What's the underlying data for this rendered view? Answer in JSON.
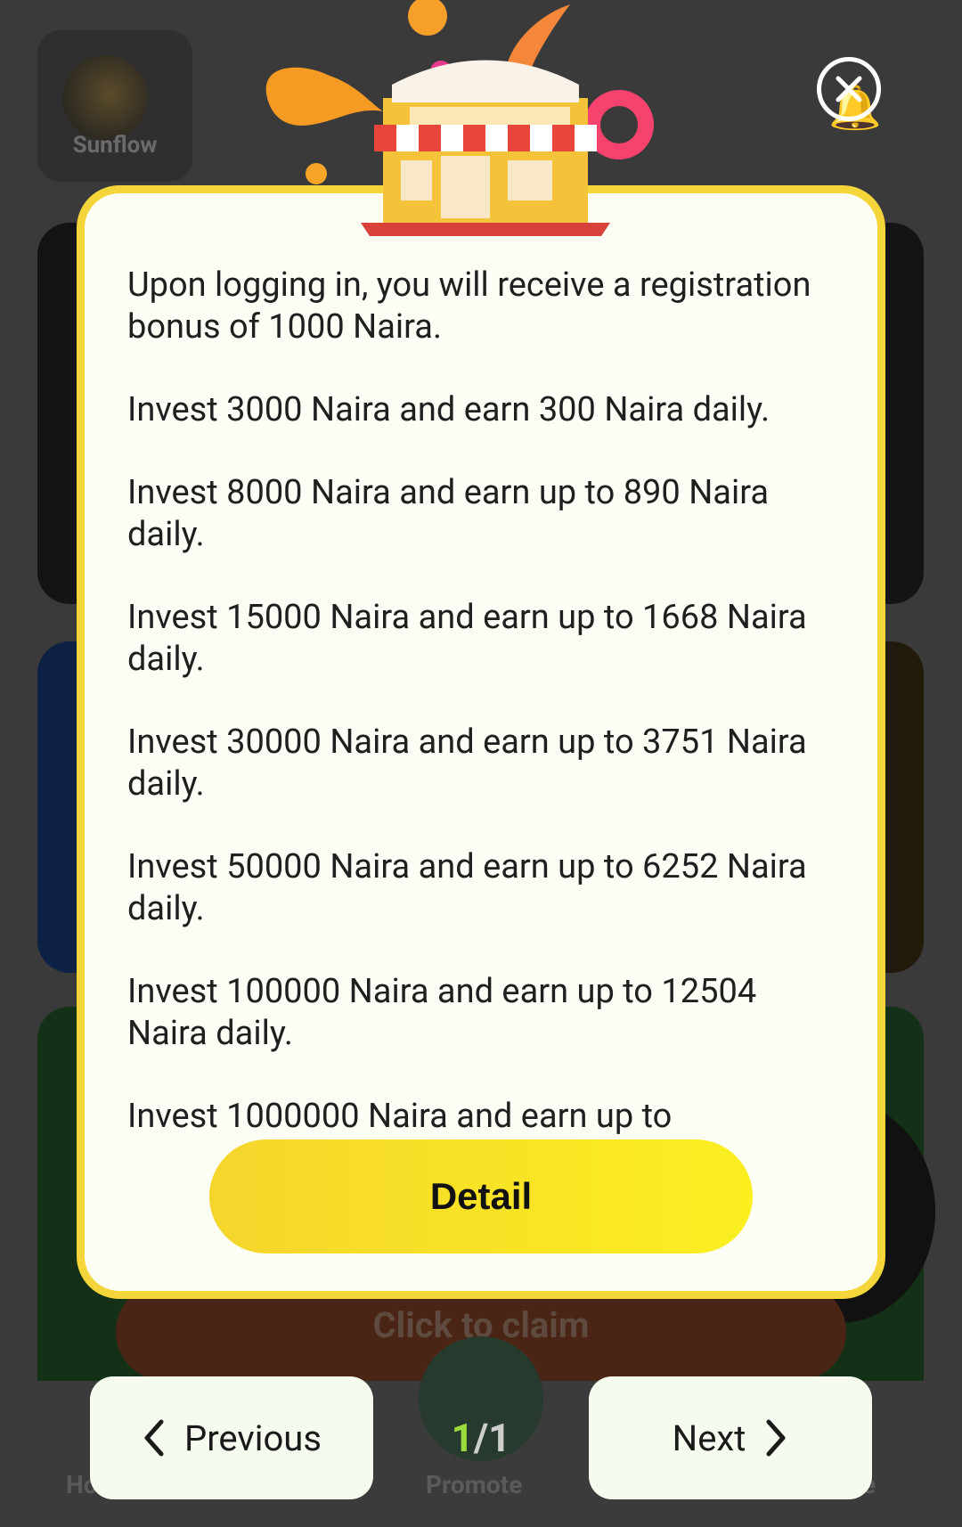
{
  "background": {
    "logo_label": "Sunflow",
    "claim_label": "Click to claim",
    "tab_promote": "Promote",
    "tab_home_partial": "Ho",
    "tab_edge_partial": "e"
  },
  "modal": {
    "paragraphs": [
      "Upon logging in, you will receive a registration bonus of 1000 Naira.",
      "Invest 3000 Naira and earn 300 Naira daily.",
      "Invest 8000 Naira and earn up to 890 Naira daily.",
      "Invest 15000 Naira and earn up to 1668 Naira daily.",
      "Invest 30000 Naira and earn up to 3751 Naira daily.",
      "Invest 50000 Naira and earn up to 6252 Naira daily.",
      "Invest 100000 Naira and earn up to 12504 Naira daily.",
      "Invest 1000000 Naira and earn up to"
    ],
    "detail_label": "Detail",
    "close_icon": "close-circle-icon"
  },
  "pager": {
    "previous_label": "Previous",
    "next_label": "Next",
    "current_page": "1",
    "total_pages": "/1"
  },
  "colors": {
    "modal_border": "#f5d63a",
    "modal_bg": "#fcfdf5",
    "detail_button": "#f8e226",
    "page_current": "#9cdc3c"
  }
}
